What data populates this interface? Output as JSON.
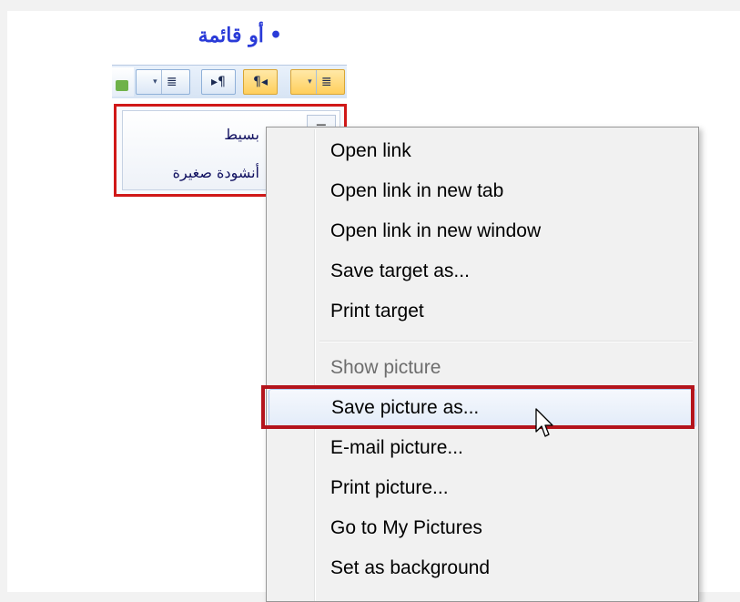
{
  "heading": {
    "bullet": "•",
    "text": "أو قائمة"
  },
  "toolbar": {
    "buttons": [
      {
        "icon": "justify-list-icon",
        "glyph": "≣",
        "dropdown": "▾"
      },
      {
        "icon": "ltr-paragraph-icon",
        "glyph": "▸¶"
      },
      {
        "icon": "rtl-paragraph-icon",
        "glyph": "¶◂"
      },
      {
        "icon": "align-right-icon",
        "glyph": "≣",
        "dropdown": "▾"
      }
    ]
  },
  "style_list": {
    "items": [
      "بسيط",
      "أنشودة صغيرة"
    ],
    "icon_glyph": "≡"
  },
  "context_menu": {
    "items": [
      {
        "label": "Open link",
        "enabled": true
      },
      {
        "label": "Open link in new tab",
        "enabled": true
      },
      {
        "label": "Open link in new window",
        "enabled": true
      },
      {
        "label": "Save target as...",
        "enabled": true
      },
      {
        "label": "Print target",
        "enabled": true
      },
      {
        "label": "Show picture",
        "enabled": false
      },
      {
        "label": "Save picture as...",
        "enabled": true,
        "highlighted": true
      },
      {
        "label": "E-mail picture...",
        "enabled": true
      },
      {
        "label": "Print picture...",
        "enabled": true
      },
      {
        "label": "Go to My Pictures",
        "enabled": true
      },
      {
        "label": "Set as background",
        "enabled": true
      }
    ]
  },
  "colors": {
    "heading": "#2a3bd8",
    "annotation_red": "#d01818",
    "menu_background": "#f1f1f1",
    "disabled_text": "#6d6d6d"
  }
}
